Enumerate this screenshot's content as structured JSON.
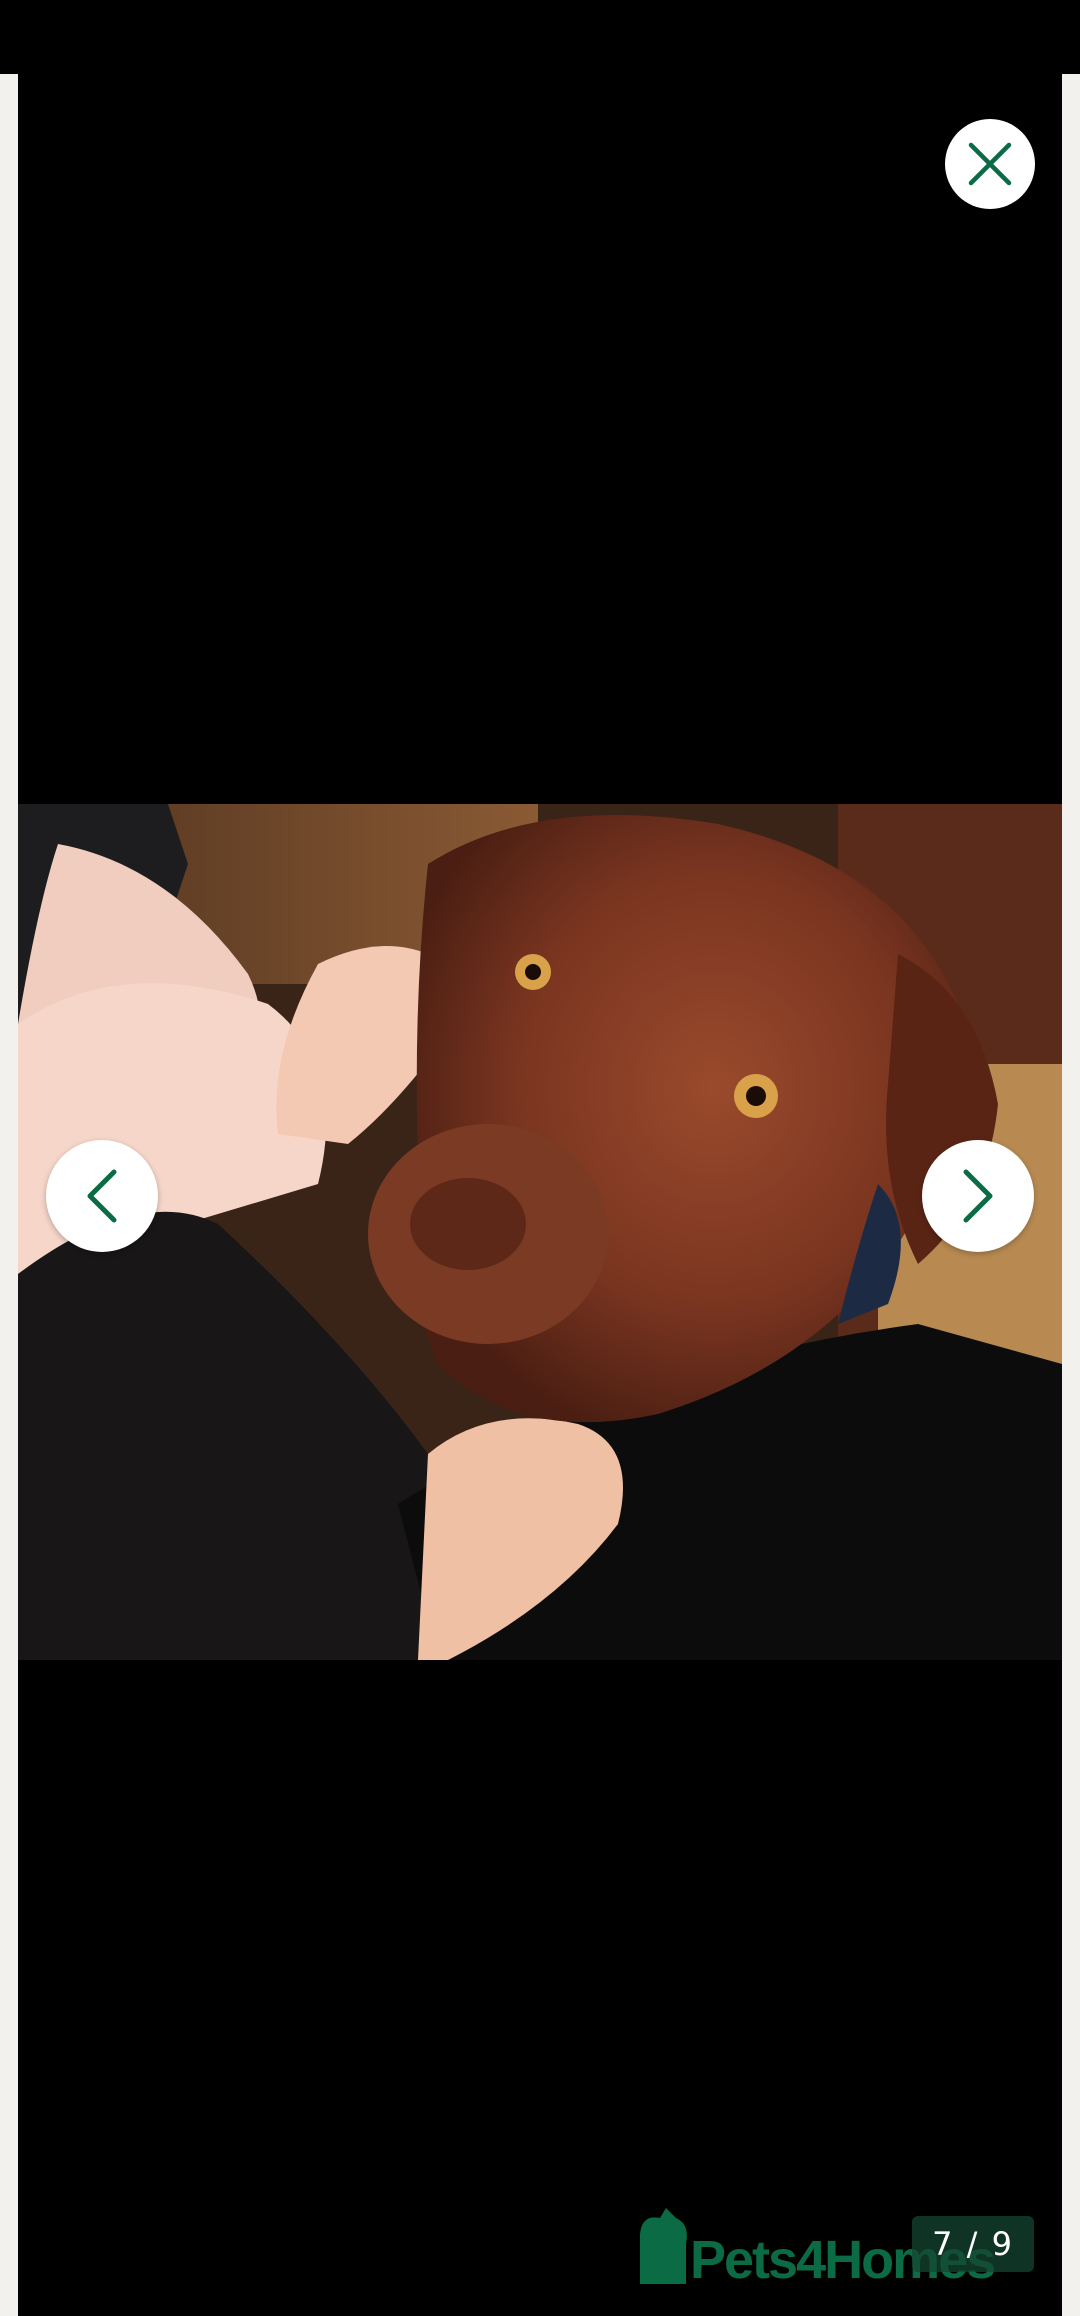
{
  "viewer": {
    "close_icon": "close-icon",
    "prev_icon": "chevron-left-icon",
    "next_icon": "chevron-right-icon",
    "counter": "7 / 9",
    "brand_watermark": "Pets4Homes",
    "accent_color": "#0b6b45"
  }
}
